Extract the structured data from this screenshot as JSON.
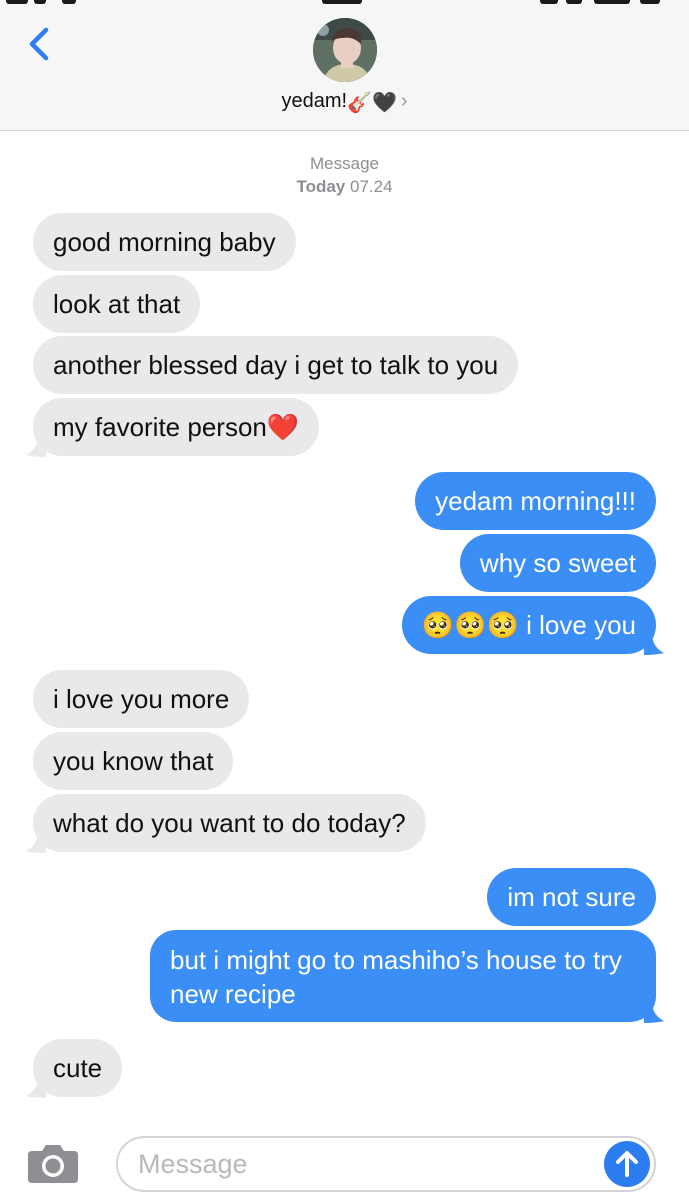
{
  "header": {
    "contact_name": "yedam!",
    "contact_emojis": "🎸🖤",
    "chevron": "›"
  },
  "timestamp": {
    "service": "Message",
    "day": "Today",
    "time": "07.24"
  },
  "messages": [
    {
      "from": "them",
      "text": "good morning baby"
    },
    {
      "from": "them",
      "text": "look at that"
    },
    {
      "from": "them",
      "text": "another blessed day i get to talk to you"
    },
    {
      "from": "them",
      "text": "my favorite person❤️"
    },
    {
      "from": "me",
      "text": "yedam morning!!!"
    },
    {
      "from": "me",
      "text": "why so sweet"
    },
    {
      "from": "me",
      "text": "🥺🥺🥺 i love you"
    },
    {
      "from": "them",
      "text": "i love you more"
    },
    {
      "from": "them",
      "text": "you know that"
    },
    {
      "from": "them",
      "text": "what do you want to do today?"
    },
    {
      "from": "me",
      "text": "im not sure"
    },
    {
      "from": "me",
      "text": "but i might go to mashiho’s house to try new recipe"
    },
    {
      "from": "them",
      "text": "cute"
    }
  ],
  "composer": {
    "placeholder": "Message",
    "camera_icon": "camera-icon",
    "send_icon": "arrow-up-icon"
  },
  "colors": {
    "incoming_bubble": "#e9e9eb",
    "outgoing_bubble": "#3b8ef5",
    "accent": "#2c7cf2"
  }
}
